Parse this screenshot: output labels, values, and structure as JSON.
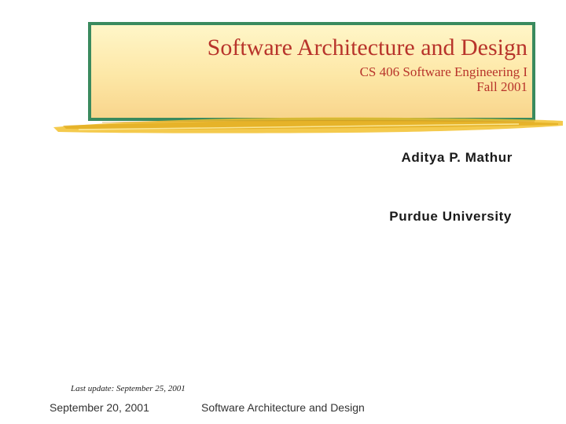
{
  "slide": {
    "title": "Software Architecture and Design",
    "subtitle_line1": "CS 406 Software Engineering I",
    "subtitle_line2": "Fall 2001",
    "author": "Aditya P. Mathur",
    "university": "Purdue University",
    "last_update": "Last update: September 25, 2001"
  },
  "footer": {
    "date": "September 20, 2001",
    "title": "Software Architecture and Design"
  },
  "colors": {
    "title_text": "#b8342b",
    "box_border": "#3a8a5e",
    "box_fill": "#fde7a6",
    "brush_stroke": "#f2c12e"
  }
}
